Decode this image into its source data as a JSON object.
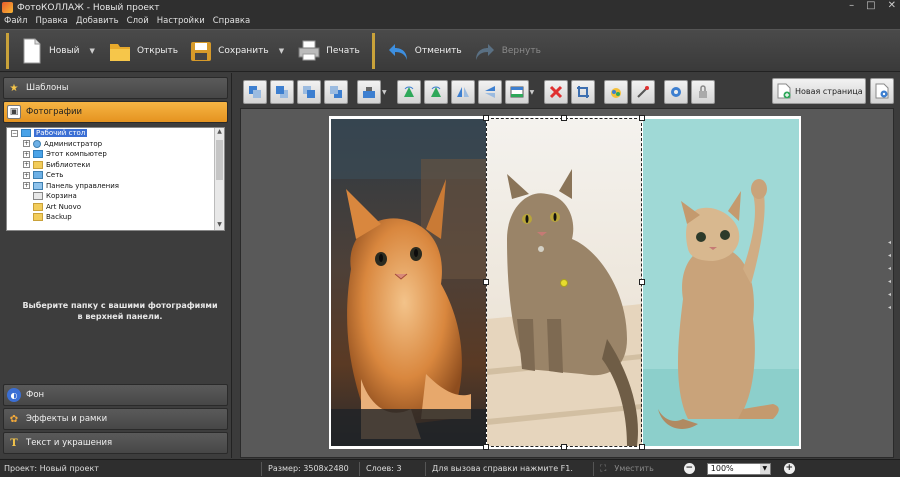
{
  "window": {
    "title": "ФотоКОЛЛАЖ - Новый проект",
    "controls": [
      "–",
      "□",
      "✕"
    ]
  },
  "menu": [
    "Файл",
    "Правка",
    "Добавить",
    "Слой",
    "Настройки",
    "Справка"
  ],
  "toolbar": {
    "new_label": "Новый",
    "open_label": "Открыть",
    "save_label": "Сохранить",
    "print_label": "Печать",
    "undo_label": "Отменить",
    "redo_label": "Вернуть"
  },
  "left_panel": {
    "sections": {
      "templates": "Шаблоны",
      "photos": "Фотографии",
      "background": "Фон",
      "effects": "Эффекты и рамки",
      "text": "Текст и украшения"
    },
    "tree": [
      {
        "label": "Рабочий стол",
        "selected": true
      },
      {
        "label": "Администратор"
      },
      {
        "label": "Этот компьютер"
      },
      {
        "label": "Библиотеки"
      },
      {
        "label": "Сеть"
      },
      {
        "label": "Панель управления"
      },
      {
        "label": "Корзина"
      },
      {
        "label": "Art Nuovo"
      },
      {
        "label": "Backup"
      }
    ],
    "hint": "Выберите папку с вашими фотографиями в верхней панели."
  },
  "editor": {
    "new_page_label": "Новая страница"
  },
  "status": {
    "project_label": "Проект:",
    "project_name": "Новый проект",
    "size_label": "Размер:",
    "size_value": "3508x2480",
    "layers_label": "Слоев:",
    "layers_value": "3",
    "help_text": "Для вызова справки нажмите F1.",
    "fit_label": "Уместить",
    "zoom_value": "100%"
  },
  "colors": {
    "accent": "#e59320",
    "selection": "#3b6fd4"
  }
}
